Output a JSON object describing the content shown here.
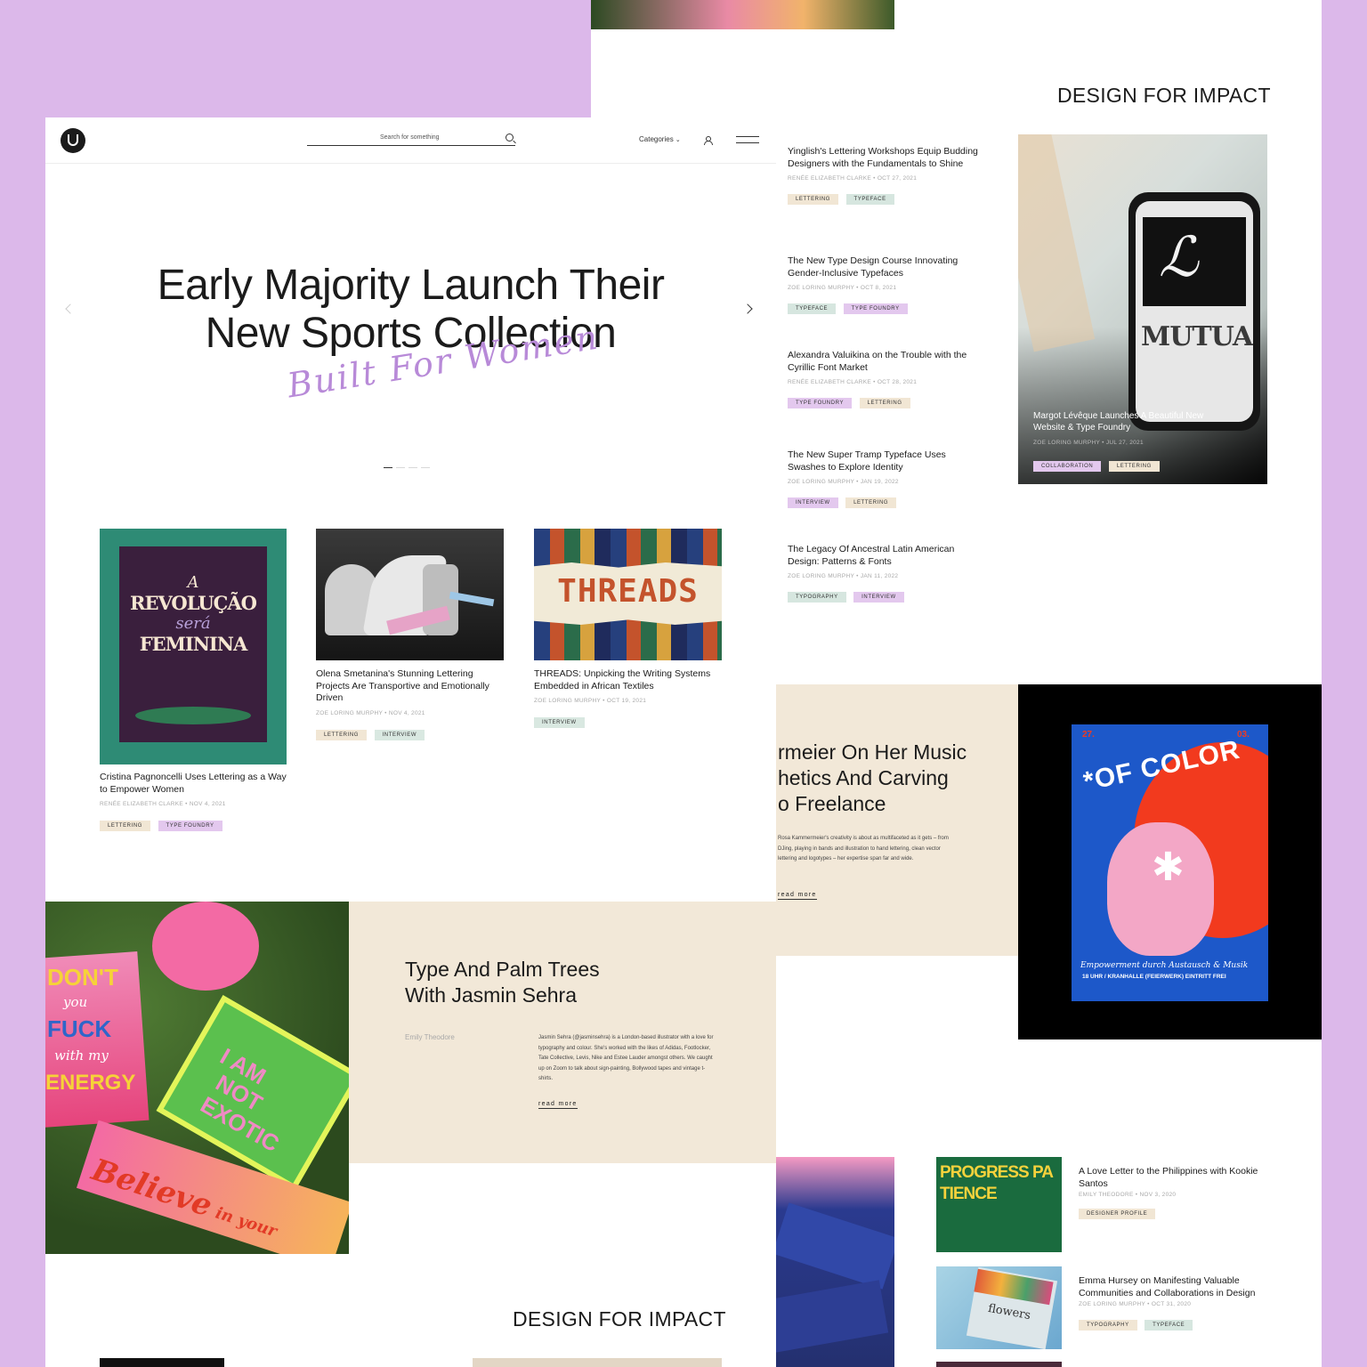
{
  "back": {
    "section_title": "DESIGN FOR IMPACT",
    "list": [
      {
        "title": "Yinglish's Lettering Workshops Equip Budding Designers with the Fundamentals to Shine",
        "author": "RENÉE ELIZABETH CLARKE",
        "date": "OCT 27, 2021",
        "tags": [
          "LETTERING",
          "TYPEFACE"
        ]
      },
      {
        "title": "The New Type Design Course Innovating Gender-Inclusive Typefaces",
        "author": "ZOE LORING MURPHY",
        "date": "OCT 8, 2021",
        "tags": [
          "TYPEFACE",
          "TYPE FOUNDRY"
        ]
      },
      {
        "title": "Alexandra Valuikina on the Trouble with the Cyrillic Font Market",
        "author": "RENÉE ELIZABETH CLARKE",
        "date": "OCT 28, 2021",
        "tags": [
          "TYPE FOUNDRY",
          "LETTERING"
        ]
      },
      {
        "title": "The New Super Tramp Typeface Uses Swashes to Explore Identity",
        "author": "ZOE LORING MURPHY",
        "date": "JAN 19, 2022",
        "tags": [
          "INTERVIEW",
          "LETTERING"
        ]
      },
      {
        "title": "The Legacy Of Ancestral Latin American Design: Patterns & Fonts",
        "author": "ZOE LORING MURPHY",
        "date": "JAN 11, 2022",
        "tags": [
          "TYPOGRAPHY",
          "INTERVIEW"
        ]
      }
    ],
    "feature": {
      "title": "Margot Lévêque Launches A Beautiful New Website & Type Foundry",
      "author": "ZOE LORING MURPHY",
      "date": "JUL 27, 2021",
      "tags": [
        "COLLABORATION",
        "LETTERING"
      ],
      "phone_text": "MUTUAL"
    },
    "story": {
      "title_l1": "rmeier On Her Music",
      "title_l2": "hetics And Carving",
      "title_l3": "o Freelance",
      "body": "Rosa Kammermeier's creativity is about as multifaceted as it gets – from DJing, playing in bands and illustration to hand lettering, clean vector lettering and logotypes – her expertise span far and wide.",
      "read_more": "read more"
    },
    "poster": {
      "top_left": "27.",
      "top_right": "03.",
      "headline": "*OF COLOR",
      "bottom": "Empowerment durch Austausch & Musik",
      "venue": "18 UHR / KRANHALLE (FEIERWERK) EINTRITT FREI"
    },
    "bottom_list": [
      {
        "title": "A Love Letter to the Philippines with Kookie Santos",
        "author": "EMILY THEODORE",
        "date": "NOV 3, 2020",
        "tags": [
          "DESIGNER PROFILE"
        ],
        "img_text": "PROGRESS PATIENCE"
      },
      {
        "title": "Emma Hursey on Manifesting Valuable Communities and Collaborations in Design",
        "author": "ZOE LORING MURPHY",
        "date": "OCT 31, 2020",
        "tags": [
          "TYPOGRAPHY",
          "TYPEFACE"
        ],
        "img_text": "flowers"
      }
    ]
  },
  "front": {
    "search_placeholder": "Search for something",
    "categories_label": "Categories",
    "hero_l1": "Early Majority Launch Their",
    "hero_l2": "New Sports Collection",
    "hero_script": "Built For Women",
    "cards": [
      {
        "title": "Cristina Pagnoncelli Uses Lettering as a Way to Empower Women",
        "author": "RENÉE ELIZABETH CLARKE",
        "date": "NOV 4, 2021",
        "tags": [
          "LETTERING",
          "TYPE FOUNDRY"
        ],
        "img_l1": "A",
        "img_l2": "REVOLUÇÃO",
        "img_l3": "será",
        "img_l4": "FEMININA"
      },
      {
        "title": "Olena Smetanina's Stunning Lettering Projects Are Transportive and Emotionally Driven",
        "author": "ZOE LORING MURPHY",
        "date": "NOV 4, 2021",
        "tags": [
          "LETTERING",
          "INTERVIEW"
        ]
      },
      {
        "title": "THREADS: Unpicking the Writing Systems Embedded in African Textiles",
        "author": "ZOE LORING MURPHY",
        "date": "OCT 19, 2021",
        "tags": [
          "INTERVIEW"
        ],
        "img_text": "THREADS"
      }
    ],
    "story": {
      "title_l1": "Type And Palm Trees",
      "title_l2": "With Jasmin Sehra",
      "author": "Emily Theodore",
      "body": "Jasmin Sehra (@jasminsehra) is a London-based illustrator with a love for typography and colour. She's worked with the likes of Adidas, Footlocker, Tate Collective, Levis, Nike and Estee Lauder amongst others. We caught up on Zoom to talk about sign-painting, Bollywood tapes and vintage t-shirts.",
      "read_more": "read more",
      "signs": [
        "DON'T",
        "you",
        "FUCK",
        "with my",
        "ENERGY",
        "I AM",
        "NOT",
        "EXOTIC",
        "Believe",
        "in your"
      ]
    },
    "section_title": "DESIGN FOR IMPACT"
  }
}
